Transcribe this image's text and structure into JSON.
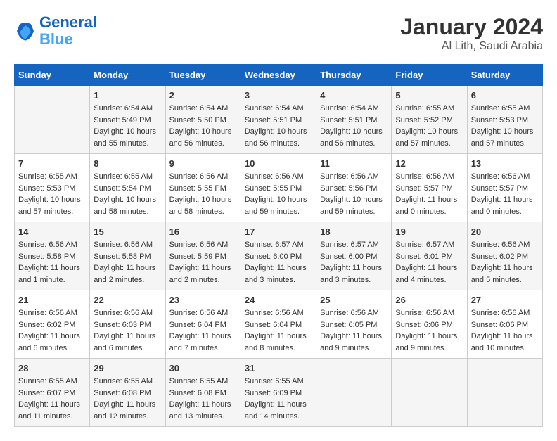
{
  "header": {
    "logo_line1": "General",
    "logo_line2": "Blue",
    "title": "January 2024",
    "subtitle": "Al Lith, Saudi Arabia"
  },
  "columns": [
    "Sunday",
    "Monday",
    "Tuesday",
    "Wednesday",
    "Thursday",
    "Friday",
    "Saturday"
  ],
  "weeks": [
    [
      {
        "day": "",
        "info": ""
      },
      {
        "day": "1",
        "info": "Sunrise: 6:54 AM\nSunset: 5:49 PM\nDaylight: 10 hours\nand 55 minutes."
      },
      {
        "day": "2",
        "info": "Sunrise: 6:54 AM\nSunset: 5:50 PM\nDaylight: 10 hours\nand 56 minutes."
      },
      {
        "day": "3",
        "info": "Sunrise: 6:54 AM\nSunset: 5:51 PM\nDaylight: 10 hours\nand 56 minutes."
      },
      {
        "day": "4",
        "info": "Sunrise: 6:54 AM\nSunset: 5:51 PM\nDaylight: 10 hours\nand 56 minutes."
      },
      {
        "day": "5",
        "info": "Sunrise: 6:55 AM\nSunset: 5:52 PM\nDaylight: 10 hours\nand 57 minutes."
      },
      {
        "day": "6",
        "info": "Sunrise: 6:55 AM\nSunset: 5:53 PM\nDaylight: 10 hours\nand 57 minutes."
      }
    ],
    [
      {
        "day": "7",
        "info": "Sunrise: 6:55 AM\nSunset: 5:53 PM\nDaylight: 10 hours\nand 57 minutes."
      },
      {
        "day": "8",
        "info": "Sunrise: 6:55 AM\nSunset: 5:54 PM\nDaylight: 10 hours\nand 58 minutes."
      },
      {
        "day": "9",
        "info": "Sunrise: 6:56 AM\nSunset: 5:55 PM\nDaylight: 10 hours\nand 58 minutes."
      },
      {
        "day": "10",
        "info": "Sunrise: 6:56 AM\nSunset: 5:55 PM\nDaylight: 10 hours\nand 59 minutes."
      },
      {
        "day": "11",
        "info": "Sunrise: 6:56 AM\nSunset: 5:56 PM\nDaylight: 10 hours\nand 59 minutes."
      },
      {
        "day": "12",
        "info": "Sunrise: 6:56 AM\nSunset: 5:57 PM\nDaylight: 11 hours\nand 0 minutes."
      },
      {
        "day": "13",
        "info": "Sunrise: 6:56 AM\nSunset: 5:57 PM\nDaylight: 11 hours\nand 0 minutes."
      }
    ],
    [
      {
        "day": "14",
        "info": "Sunrise: 6:56 AM\nSunset: 5:58 PM\nDaylight: 11 hours\nand 1 minute."
      },
      {
        "day": "15",
        "info": "Sunrise: 6:56 AM\nSunset: 5:58 PM\nDaylight: 11 hours\nand 2 minutes."
      },
      {
        "day": "16",
        "info": "Sunrise: 6:56 AM\nSunset: 5:59 PM\nDaylight: 11 hours\nand 2 minutes."
      },
      {
        "day": "17",
        "info": "Sunrise: 6:57 AM\nSunset: 6:00 PM\nDaylight: 11 hours\nand 3 minutes."
      },
      {
        "day": "18",
        "info": "Sunrise: 6:57 AM\nSunset: 6:00 PM\nDaylight: 11 hours\nand 3 minutes."
      },
      {
        "day": "19",
        "info": "Sunrise: 6:57 AM\nSunset: 6:01 PM\nDaylight: 11 hours\nand 4 minutes."
      },
      {
        "day": "20",
        "info": "Sunrise: 6:56 AM\nSunset: 6:02 PM\nDaylight: 11 hours\nand 5 minutes."
      }
    ],
    [
      {
        "day": "21",
        "info": "Sunrise: 6:56 AM\nSunset: 6:02 PM\nDaylight: 11 hours\nand 6 minutes."
      },
      {
        "day": "22",
        "info": "Sunrise: 6:56 AM\nSunset: 6:03 PM\nDaylight: 11 hours\nand 6 minutes."
      },
      {
        "day": "23",
        "info": "Sunrise: 6:56 AM\nSunset: 6:04 PM\nDaylight: 11 hours\nand 7 minutes."
      },
      {
        "day": "24",
        "info": "Sunrise: 6:56 AM\nSunset: 6:04 PM\nDaylight: 11 hours\nand 8 minutes."
      },
      {
        "day": "25",
        "info": "Sunrise: 6:56 AM\nSunset: 6:05 PM\nDaylight: 11 hours\nand 9 minutes."
      },
      {
        "day": "26",
        "info": "Sunrise: 6:56 AM\nSunset: 6:06 PM\nDaylight: 11 hours\nand 9 minutes."
      },
      {
        "day": "27",
        "info": "Sunrise: 6:56 AM\nSunset: 6:06 PM\nDaylight: 11 hours\nand 10 minutes."
      }
    ],
    [
      {
        "day": "28",
        "info": "Sunrise: 6:55 AM\nSunset: 6:07 PM\nDaylight: 11 hours\nand 11 minutes."
      },
      {
        "day": "29",
        "info": "Sunrise: 6:55 AM\nSunset: 6:08 PM\nDaylight: 11 hours\nand 12 minutes."
      },
      {
        "day": "30",
        "info": "Sunrise: 6:55 AM\nSunset: 6:08 PM\nDaylight: 11 hours\nand 13 minutes."
      },
      {
        "day": "31",
        "info": "Sunrise: 6:55 AM\nSunset: 6:09 PM\nDaylight: 11 hours\nand 14 minutes."
      },
      {
        "day": "",
        "info": ""
      },
      {
        "day": "",
        "info": ""
      },
      {
        "day": "",
        "info": ""
      }
    ]
  ]
}
